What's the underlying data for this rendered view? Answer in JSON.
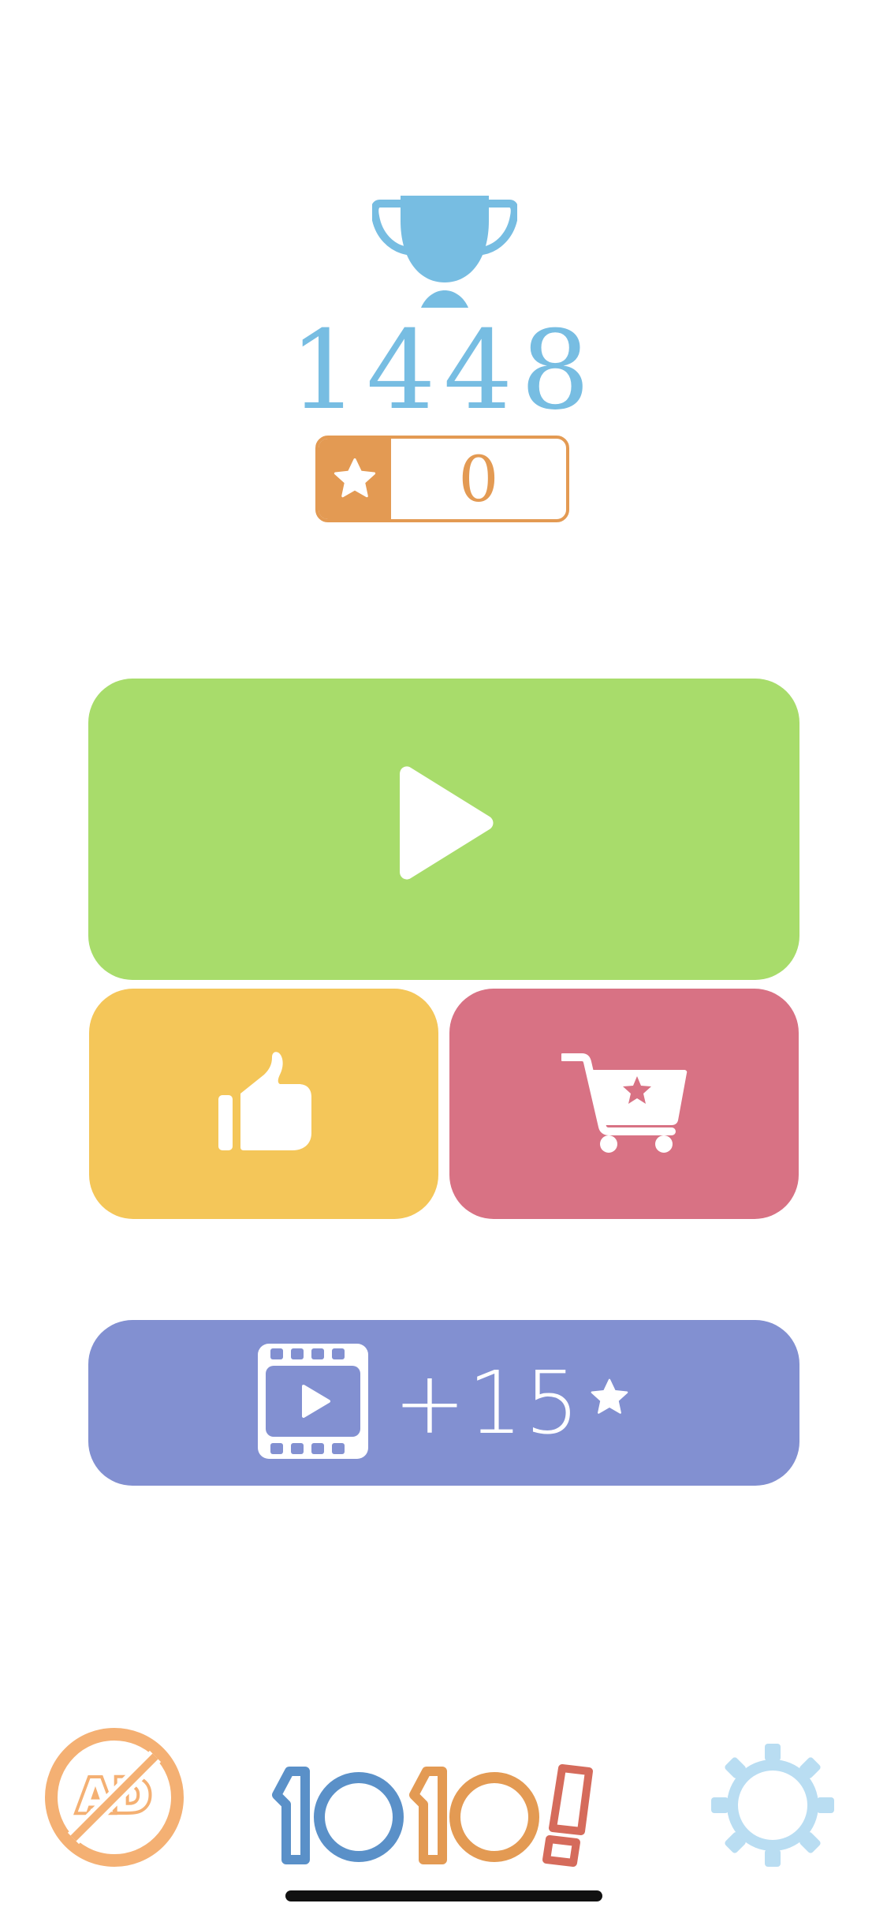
{
  "scores": {
    "high_score": "1448",
    "stars": "0"
  },
  "buttons": {
    "play": {
      "icon": "play-icon"
    },
    "rate": {
      "icon": "thumbs-up-icon"
    },
    "shop": {
      "icon": "cart-star-icon"
    },
    "video_reward": {
      "icon": "video-film-icon",
      "label": "+15",
      "suffix_icon": "star-icon"
    }
  },
  "bottom_bar": {
    "no_ads_icon": "no-ads-icon",
    "logo_icon": "1010-logo",
    "settings_icon": "gear-icon"
  },
  "colors": {
    "trophy": "#77bde2",
    "stars_accent": "#e39a53",
    "play": "#a8dc6b",
    "rate": "#f4c659",
    "shop": "#d87284",
    "video_reward": "#8290d1",
    "no_ads": "#f4b073",
    "settings": "#b9ddf2",
    "logo_blue": "#5a90c8",
    "logo_orange": "#e39a53",
    "logo_red": "#d56b5b"
  }
}
